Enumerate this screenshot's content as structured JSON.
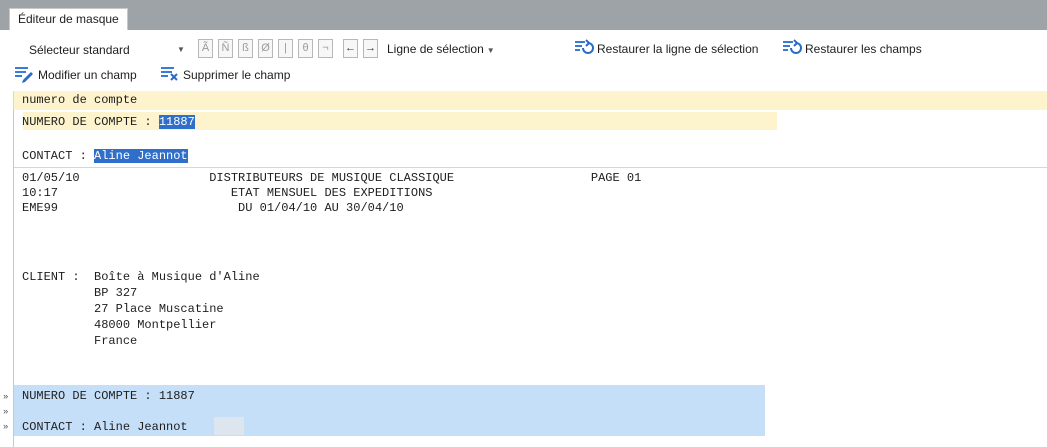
{
  "tab": {
    "title": "Éditeur de masque"
  },
  "toolbar": {
    "selector": {
      "label": "Sélecteur standard"
    },
    "glyph_buttons": [
      "Ã",
      "Ñ",
      "ß",
      "Ø",
      "|",
      "θ",
      "¬"
    ],
    "arrows": [
      "←",
      "→"
    ],
    "line_selection": {
      "label": "Ligne de sélection"
    },
    "restore_line": {
      "label": "Restaurer la ligne de sélection"
    },
    "restore_fields": {
      "label": "Restaurer les champs"
    },
    "modify_field": {
      "label": "Modifier un champ"
    },
    "delete_field": {
      "label": "Supprimer le champ"
    }
  },
  "header_row": {
    "text": "numero de compte"
  },
  "fields": {
    "account_label": "NUMERO DE COMPTE : ",
    "account_value": "11887",
    "contact_label": "CONTACT : ",
    "contact_value": "Aline Jeannot"
  },
  "report": {
    "lines": [
      "01/05/10                  DISTRIBUTEURS DE MUSIQUE CLASSIQUE                   PAGE 01",
      "10:17                        ETAT MENSUEL DES EXPEDITIONS",
      "EME99                         DU 01/04/10 AU 30/04/10",
      "",
      "",
      "",
      "CLIENT :  Boîte à Musique d'Aline",
      "          BP 327",
      "          27 Place Muscatine",
      "          48000 Montpellier",
      "          France"
    ],
    "selected_block": {
      "markers": [
        "»",
        "»",
        "»"
      ],
      "lines": [
        "NUMERO DE COMPTE : 11887",
        "",
        "CONTACT : Aline Jeannot"
      ]
    }
  }
}
